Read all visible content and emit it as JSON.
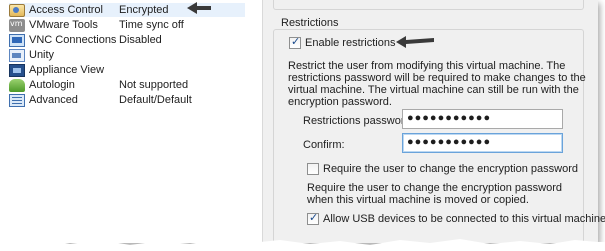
{
  "settings_list": {
    "items": [
      {
        "name": "Access Control",
        "value": "Encrypted",
        "icon": "lock-icon",
        "selected": true
      },
      {
        "name": "VMware Tools",
        "value": "Time sync off",
        "icon": "vmware-tools-icon",
        "selected": false
      },
      {
        "name": "VNC Connections",
        "value": "Disabled",
        "icon": "monitor-icon",
        "selected": false
      },
      {
        "name": "Unity",
        "value": "",
        "icon": "unity-icon",
        "selected": false
      },
      {
        "name": "Appliance View",
        "value": "",
        "icon": "appliance-view-icon",
        "selected": false
      },
      {
        "name": "Autologin",
        "value": "Not supported",
        "icon": "users-icon",
        "selected": false
      },
      {
        "name": "Advanced",
        "value": "Default/Default",
        "icon": "advanced-icon",
        "selected": false
      }
    ]
  },
  "restrictions": {
    "group_title": "Restrictions",
    "enable_label": "Enable restrictions",
    "enable_checked": true,
    "description": "Restrict the user from modifying this virtual machine. The restrictions password will be required to make changes to the virtual machine. The virtual machine can still be run with the encryption password.",
    "password_label": "Restrictions password:",
    "password_value": "●●●●●●●●●●●",
    "confirm_label": "Confirm:",
    "confirm_value": "●●●●●●●●●●●",
    "require_change_label": "Require the user to change the encryption password",
    "require_change_checked": false,
    "require_change_description": "Require the user to change the encryption password when this virtual machine is moved or copied.",
    "usb_label": "Allow USB devices to be connected to this virtual machine",
    "usb_checked": true
  },
  "colors": {
    "selection": "#e7f1fc",
    "panel": "#f0f0f0",
    "check": "#1a4a8c"
  }
}
